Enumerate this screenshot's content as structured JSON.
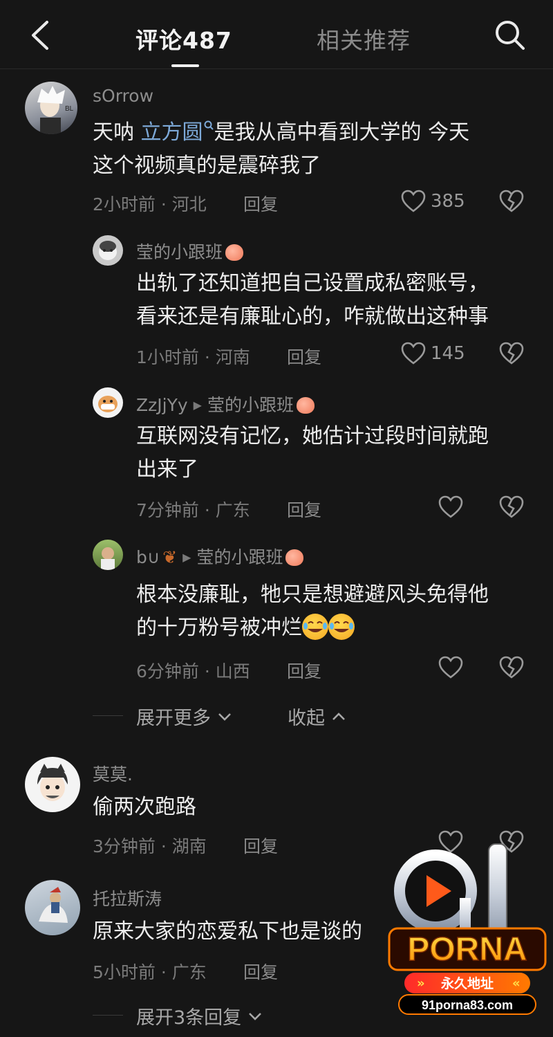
{
  "header": {
    "tab_comments": "评论487",
    "tab_related": "相关推荐"
  },
  "comments": [
    {
      "user": "sOrrow",
      "text_a": "天呐 ",
      "mention": "立方圆",
      "text_b": "是我从高中看到大学的 今天",
      "text_c": "这个视频真的是震碎我了",
      "meta": "2小时前 · 河北",
      "reply": "回复",
      "likes": "385"
    },
    {
      "user": "莹的小跟班",
      "line1": "出轨了还知道把自己设置成私密账号，",
      "line2": "看来还是有廉耻心的，咋就做出这种事",
      "meta": "1小时前 · 河南",
      "reply": "回复",
      "likes": "145"
    },
    {
      "user": "ZzJjYy",
      "reply_to": "莹的小跟班",
      "line1": "互联网没有记忆，她估计过段时间就跑",
      "line2": "出来了",
      "meta": "7分钟前 · 广东",
      "reply": "回复"
    },
    {
      "user": "b∪",
      "reply_to": "莹的小跟班",
      "line1": "根本没廉耻，牠只是想避避风头免得他",
      "line2": "的十万粉号被冲烂",
      "meta": "6分钟前 · 山西",
      "reply": "回复"
    },
    {
      "user": "莫莫.",
      "line1": "偷两次跑路",
      "meta": "3分钟前 · 湖南",
      "reply": "回复"
    },
    {
      "user": "托拉斯涛",
      "line1": "原来大家的恋爱私下也是谈的",
      "meta": "5小时前 · 广东",
      "reply": "回复"
    }
  ],
  "expand": {
    "more": "展开更多",
    "collapse": "收起",
    "three_replies": "展开3条回复"
  },
  "watermark": {
    "num": "91",
    "brand": "PORNA",
    "slogan": "永久地址",
    "url": "91porna83.com"
  }
}
